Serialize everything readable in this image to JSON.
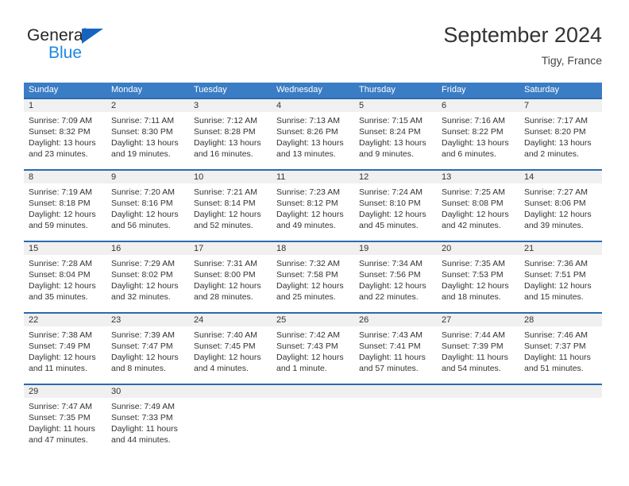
{
  "brand": {
    "line1": "General",
    "line2": "Blue",
    "triangle_color": "#1565c0",
    "blue_text_color": "#1e88e5"
  },
  "header": {
    "title": "September 2024",
    "subtitle": "Tigy, France"
  },
  "theme": {
    "header_blue": "#3b7dc4",
    "cell_band_gray": "#f0f0f0",
    "cell_band_border": "#2a6ab0",
    "text": "#333333"
  },
  "weekdays": [
    "Sunday",
    "Monday",
    "Tuesday",
    "Wednesday",
    "Thursday",
    "Friday",
    "Saturday"
  ],
  "weeks": [
    [
      {
        "date": "1",
        "sunrise": "Sunrise: 7:09 AM",
        "sunset": "Sunset: 8:32 PM",
        "daylight1": "Daylight: 13 hours",
        "daylight2": "and 23 minutes."
      },
      {
        "date": "2",
        "sunrise": "Sunrise: 7:11 AM",
        "sunset": "Sunset: 8:30 PM",
        "daylight1": "Daylight: 13 hours",
        "daylight2": "and 19 minutes."
      },
      {
        "date": "3",
        "sunrise": "Sunrise: 7:12 AM",
        "sunset": "Sunset: 8:28 PM",
        "daylight1": "Daylight: 13 hours",
        "daylight2": "and 16 minutes."
      },
      {
        "date": "4",
        "sunrise": "Sunrise: 7:13 AM",
        "sunset": "Sunset: 8:26 PM",
        "daylight1": "Daylight: 13 hours",
        "daylight2": "and 13 minutes."
      },
      {
        "date": "5",
        "sunrise": "Sunrise: 7:15 AM",
        "sunset": "Sunset: 8:24 PM",
        "daylight1": "Daylight: 13 hours",
        "daylight2": "and 9 minutes."
      },
      {
        "date": "6",
        "sunrise": "Sunrise: 7:16 AM",
        "sunset": "Sunset: 8:22 PM",
        "daylight1": "Daylight: 13 hours",
        "daylight2": "and 6 minutes."
      },
      {
        "date": "7",
        "sunrise": "Sunrise: 7:17 AM",
        "sunset": "Sunset: 8:20 PM",
        "daylight1": "Daylight: 13 hours",
        "daylight2": "and 2 minutes."
      }
    ],
    [
      {
        "date": "8",
        "sunrise": "Sunrise: 7:19 AM",
        "sunset": "Sunset: 8:18 PM",
        "daylight1": "Daylight: 12 hours",
        "daylight2": "and 59 minutes."
      },
      {
        "date": "9",
        "sunrise": "Sunrise: 7:20 AM",
        "sunset": "Sunset: 8:16 PM",
        "daylight1": "Daylight: 12 hours",
        "daylight2": "and 56 minutes."
      },
      {
        "date": "10",
        "sunrise": "Sunrise: 7:21 AM",
        "sunset": "Sunset: 8:14 PM",
        "daylight1": "Daylight: 12 hours",
        "daylight2": "and 52 minutes."
      },
      {
        "date": "11",
        "sunrise": "Sunrise: 7:23 AM",
        "sunset": "Sunset: 8:12 PM",
        "daylight1": "Daylight: 12 hours",
        "daylight2": "and 49 minutes."
      },
      {
        "date": "12",
        "sunrise": "Sunrise: 7:24 AM",
        "sunset": "Sunset: 8:10 PM",
        "daylight1": "Daylight: 12 hours",
        "daylight2": "and 45 minutes."
      },
      {
        "date": "13",
        "sunrise": "Sunrise: 7:25 AM",
        "sunset": "Sunset: 8:08 PM",
        "daylight1": "Daylight: 12 hours",
        "daylight2": "and 42 minutes."
      },
      {
        "date": "14",
        "sunrise": "Sunrise: 7:27 AM",
        "sunset": "Sunset: 8:06 PM",
        "daylight1": "Daylight: 12 hours",
        "daylight2": "and 39 minutes."
      }
    ],
    [
      {
        "date": "15",
        "sunrise": "Sunrise: 7:28 AM",
        "sunset": "Sunset: 8:04 PM",
        "daylight1": "Daylight: 12 hours",
        "daylight2": "and 35 minutes."
      },
      {
        "date": "16",
        "sunrise": "Sunrise: 7:29 AM",
        "sunset": "Sunset: 8:02 PM",
        "daylight1": "Daylight: 12 hours",
        "daylight2": "and 32 minutes."
      },
      {
        "date": "17",
        "sunrise": "Sunrise: 7:31 AM",
        "sunset": "Sunset: 8:00 PM",
        "daylight1": "Daylight: 12 hours",
        "daylight2": "and 28 minutes."
      },
      {
        "date": "18",
        "sunrise": "Sunrise: 7:32 AM",
        "sunset": "Sunset: 7:58 PM",
        "daylight1": "Daylight: 12 hours",
        "daylight2": "and 25 minutes."
      },
      {
        "date": "19",
        "sunrise": "Sunrise: 7:34 AM",
        "sunset": "Sunset: 7:56 PM",
        "daylight1": "Daylight: 12 hours",
        "daylight2": "and 22 minutes."
      },
      {
        "date": "20",
        "sunrise": "Sunrise: 7:35 AM",
        "sunset": "Sunset: 7:53 PM",
        "daylight1": "Daylight: 12 hours",
        "daylight2": "and 18 minutes."
      },
      {
        "date": "21",
        "sunrise": "Sunrise: 7:36 AM",
        "sunset": "Sunset: 7:51 PM",
        "daylight1": "Daylight: 12 hours",
        "daylight2": "and 15 minutes."
      }
    ],
    [
      {
        "date": "22",
        "sunrise": "Sunrise: 7:38 AM",
        "sunset": "Sunset: 7:49 PM",
        "daylight1": "Daylight: 12 hours",
        "daylight2": "and 11 minutes."
      },
      {
        "date": "23",
        "sunrise": "Sunrise: 7:39 AM",
        "sunset": "Sunset: 7:47 PM",
        "daylight1": "Daylight: 12 hours",
        "daylight2": "and 8 minutes."
      },
      {
        "date": "24",
        "sunrise": "Sunrise: 7:40 AM",
        "sunset": "Sunset: 7:45 PM",
        "daylight1": "Daylight: 12 hours",
        "daylight2": "and 4 minutes."
      },
      {
        "date": "25",
        "sunrise": "Sunrise: 7:42 AM",
        "sunset": "Sunset: 7:43 PM",
        "daylight1": "Daylight: 12 hours",
        "daylight2": "and 1 minute."
      },
      {
        "date": "26",
        "sunrise": "Sunrise: 7:43 AM",
        "sunset": "Sunset: 7:41 PM",
        "daylight1": "Daylight: 11 hours",
        "daylight2": "and 57 minutes."
      },
      {
        "date": "27",
        "sunrise": "Sunrise: 7:44 AM",
        "sunset": "Sunset: 7:39 PM",
        "daylight1": "Daylight: 11 hours",
        "daylight2": "and 54 minutes."
      },
      {
        "date": "28",
        "sunrise": "Sunrise: 7:46 AM",
        "sunset": "Sunset: 7:37 PM",
        "daylight1": "Daylight: 11 hours",
        "daylight2": "and 51 minutes."
      }
    ],
    [
      {
        "date": "29",
        "sunrise": "Sunrise: 7:47 AM",
        "sunset": "Sunset: 7:35 PM",
        "daylight1": "Daylight: 11 hours",
        "daylight2": "and 47 minutes."
      },
      {
        "date": "30",
        "sunrise": "Sunrise: 7:49 AM",
        "sunset": "Sunset: 7:33 PM",
        "daylight1": "Daylight: 11 hours",
        "daylight2": "and 44 minutes."
      },
      {
        "date": "",
        "sunrise": "",
        "sunset": "",
        "daylight1": "",
        "daylight2": ""
      },
      {
        "date": "",
        "sunrise": "",
        "sunset": "",
        "daylight1": "",
        "daylight2": ""
      },
      {
        "date": "",
        "sunrise": "",
        "sunset": "",
        "daylight1": "",
        "daylight2": ""
      },
      {
        "date": "",
        "sunrise": "",
        "sunset": "",
        "daylight1": "",
        "daylight2": ""
      },
      {
        "date": "",
        "sunrise": "",
        "sunset": "",
        "daylight1": "",
        "daylight2": ""
      }
    ]
  ]
}
